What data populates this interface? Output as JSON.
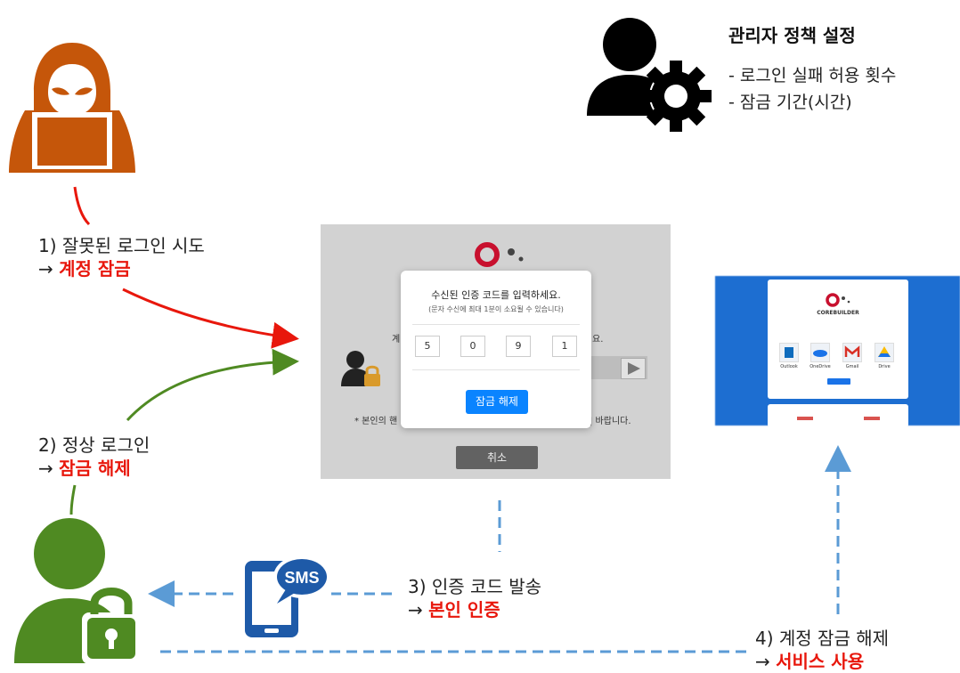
{
  "policy": {
    "title": "관리자 정책 설정",
    "items": [
      "- 로그인 실패 허용 횟수",
      "- 잠금 기간(시간)"
    ]
  },
  "steps": {
    "s1_line1": "1) 잘못된 로그인 시도",
    "s1_arrow": "→",
    "s1_hl": "계정 잠금",
    "s2_line1": "2) 정상 로그인",
    "s2_arrow": "→",
    "s2_hl": "잠금 해제",
    "s3_line1": "3) 인증 코드 발송",
    "s3_arrow": "→",
    "s3_hl": "본인 인증",
    "s4_line1": "4) 계정 잠금 해제",
    "s4_arrow": "→",
    "s4_hl": "서비스 사용"
  },
  "panel": {
    "left_text": "계",
    "right_text": "요.",
    "note_left": "* 본인의 핸",
    "note_right": "| 바랍니다.",
    "cancel_label": "취소"
  },
  "modal": {
    "title": "수신된 인증 코드를 입력하세요.",
    "subtitle": "(문자 수신에 최대 1분이 소요될 수 있습니다)",
    "digits": [
      "5",
      "0",
      "9",
      "1"
    ],
    "unlock_label": "잠금 해제"
  },
  "sms": {
    "label": "SMS"
  },
  "right_app": {
    "brand": "COREBUILDER",
    "apps": [
      "Outlook",
      "OneDrive",
      "Gmail",
      "Drive"
    ]
  },
  "colors": {
    "accent_red": "#e8170c",
    "hacker_orange": "#c5560a",
    "user_green": "#4f8a22",
    "dash_blue": "#5b9bd5",
    "button_blue": "#0a84ff",
    "sms_blue": "#1e5aa8"
  },
  "icons": [
    "hacker-icon",
    "admin-gear-icon",
    "user-lock-icon",
    "sms-phone-icon",
    "brand-logo-icon"
  ]
}
